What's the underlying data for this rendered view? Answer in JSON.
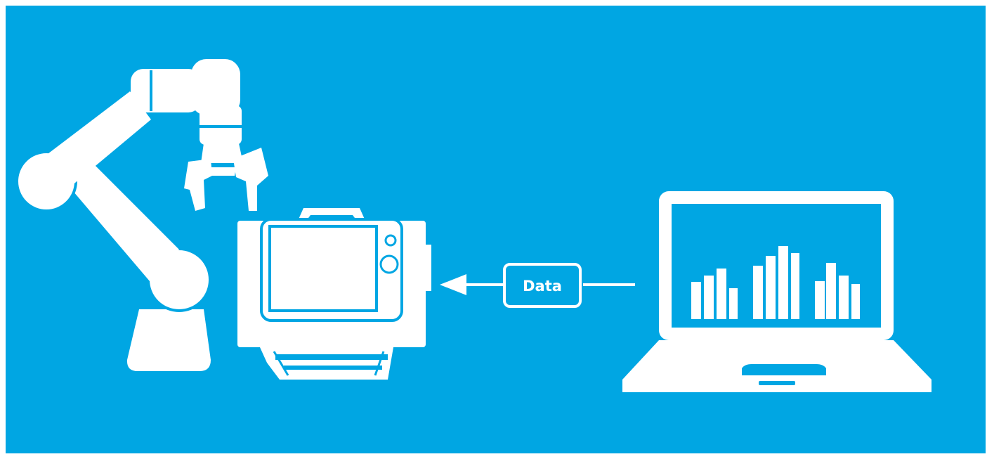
{
  "colors": {
    "background": "#00a6e3",
    "foreground": "#ffffff"
  },
  "icons": [
    "robot-arm-icon",
    "machine-device-icon",
    "laptop-icon",
    "bar-chart-icon",
    "arrow-left-icon"
  ],
  "connector": {
    "label": "Data",
    "direction": "laptop-to-device"
  }
}
